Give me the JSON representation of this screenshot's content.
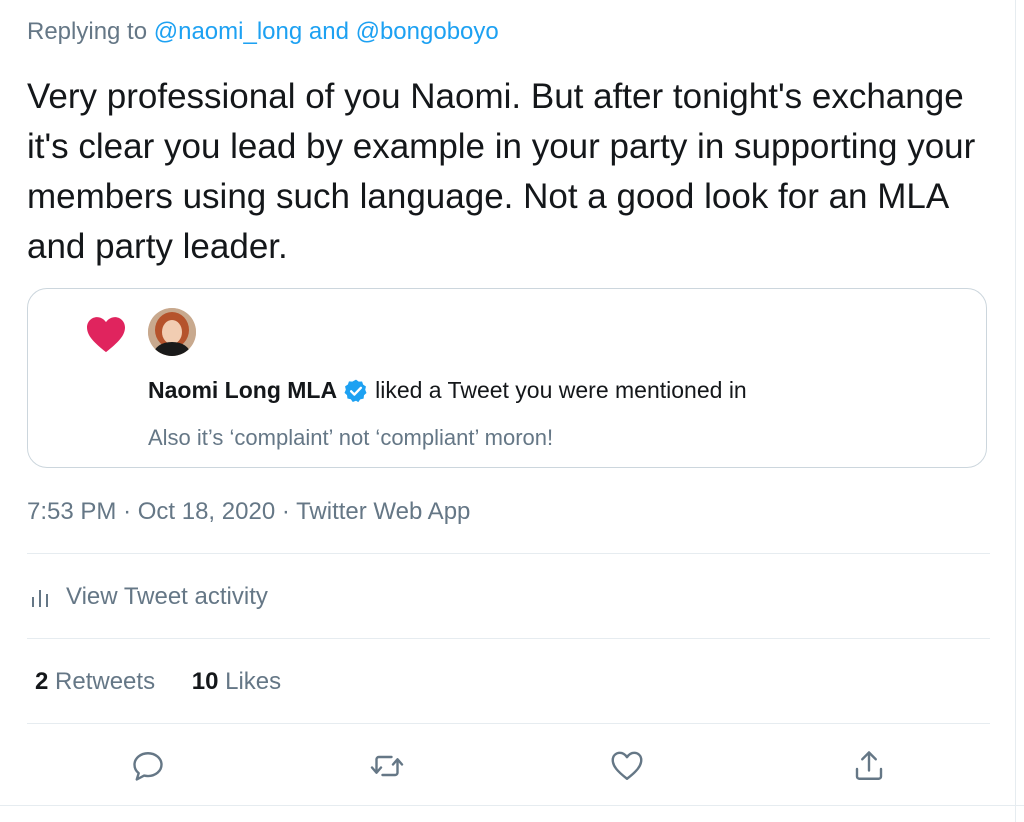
{
  "reply": {
    "prefix": "Replying to",
    "mention1": "@naomi_long",
    "conjunction": "and",
    "mention2": "@bongoboyo"
  },
  "tweet": {
    "text": "Very professional of you Naomi.  But after tonight's exchange it's clear you lead by example in your party in supporting your members using such language. Not a good look for an MLA and party leader."
  },
  "card": {
    "icon": "heart-icon",
    "user_name": "Naomi Long MLA",
    "verified": true,
    "action_text": "liked a Tweet you were mentioned in",
    "quoted_text": "Also it’s ‘complaint’ not ‘compliant’ moron!"
  },
  "meta": {
    "time": "7:53 PM",
    "date": "Oct 18, 2020",
    "source": "Twitter Web App"
  },
  "activity": {
    "label": "View Tweet activity"
  },
  "stats": {
    "retweets_count": "2",
    "retweets_label": "Retweets",
    "likes_count": "10",
    "likes_label": "Likes"
  },
  "actions": [
    "reply-icon",
    "retweet-icon",
    "like-icon",
    "share-icon"
  ],
  "colors": {
    "link": "#1da1f2",
    "muted": "#657786",
    "heart": "#e0245e",
    "border": "#ccd6dd"
  }
}
